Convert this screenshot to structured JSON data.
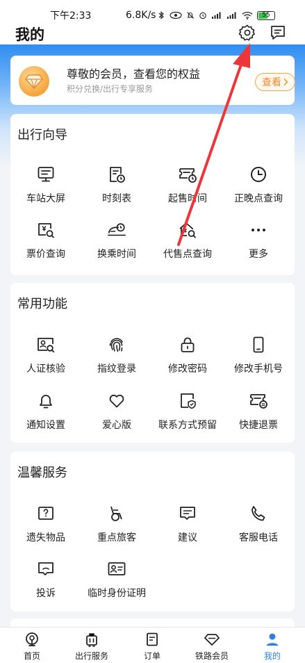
{
  "status_bar": {
    "time": "下午2:33",
    "network_speed": "6.8K/s",
    "battery": "55"
  },
  "header": {
    "title": "我的",
    "settings_icon": "gear-icon",
    "message_icon": "message-icon"
  },
  "member_card": {
    "title": "尊敬的会员，查看您的权益",
    "subtitle": "积分兑换/出行专享服务",
    "button_label": "查看"
  },
  "sections": {
    "travel_guide": {
      "title": "出行向导",
      "items": [
        {
          "label": "车站大屏",
          "icon": "station-screen-icon"
        },
        {
          "label": "时刻表",
          "icon": "timetable-icon"
        },
        {
          "label": "起售时间",
          "icon": "sale-time-icon"
        },
        {
          "label": "正晚点查询",
          "icon": "clock-icon"
        },
        {
          "label": "票价查询",
          "icon": "fare-search-icon"
        },
        {
          "label": "换乘时间",
          "icon": "transfer-time-icon"
        },
        {
          "label": "代售点查询",
          "icon": "agency-search-icon"
        },
        {
          "label": "更多",
          "icon": "more-icon"
        }
      ]
    },
    "common_functions": {
      "title": "常用功能",
      "items": [
        {
          "label": "人证核验",
          "icon": "id-verify-icon"
        },
        {
          "label": "指纹登录",
          "icon": "fingerprint-icon"
        },
        {
          "label": "修改密码",
          "icon": "lock-icon"
        },
        {
          "label": "修改手机号",
          "icon": "phone-icon"
        },
        {
          "label": "通知设置",
          "icon": "bell-icon"
        },
        {
          "label": "爱心版",
          "icon": "heart-icon"
        },
        {
          "label": "联系方式预留",
          "icon": "contact-shield-icon"
        },
        {
          "label": "快捷退票",
          "icon": "refund-ticket-icon"
        }
      ]
    },
    "warm_services": {
      "title": "温馨服务",
      "items": [
        {
          "label": "遗失物品",
          "icon": "lost-item-icon"
        },
        {
          "label": "重点旅客",
          "icon": "wheelchair-icon"
        },
        {
          "label": "建议",
          "icon": "suggestion-icon"
        },
        {
          "label": "客服电话",
          "icon": "phone-call-icon"
        },
        {
          "label": "投诉",
          "icon": "complaint-icon"
        },
        {
          "label": "临时身份证明",
          "icon": "temp-id-icon"
        }
      ]
    }
  },
  "bottom_nav": [
    {
      "label": "首页",
      "icon": "home-icon"
    },
    {
      "label": "出行服务",
      "icon": "luggage-icon"
    },
    {
      "label": "订单",
      "icon": "order-icon"
    },
    {
      "label": "铁路会员",
      "icon": "diamond-icon"
    },
    {
      "label": "我的",
      "icon": "user-icon"
    }
  ],
  "colors": {
    "accent": "#2f7fe8",
    "member_orange": "#f08a2a",
    "arrow_red": "#f0353a"
  }
}
